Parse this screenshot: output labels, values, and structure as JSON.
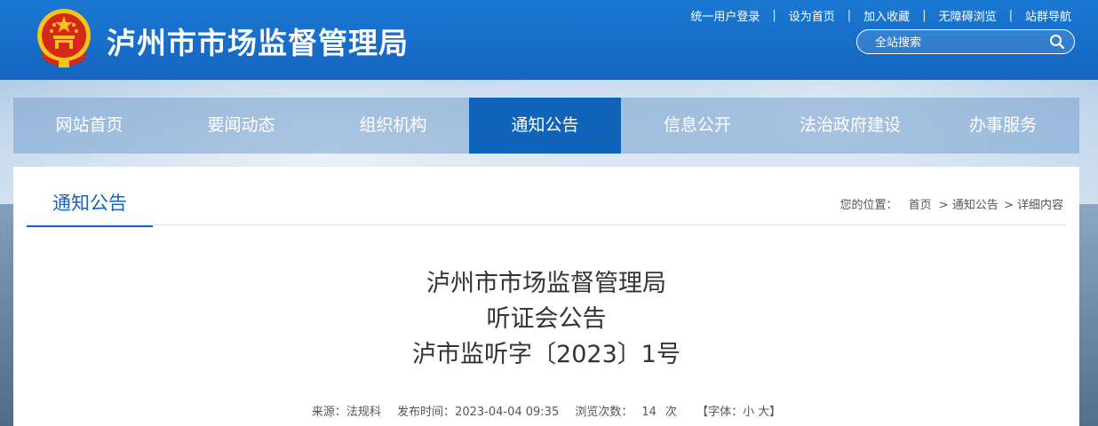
{
  "header": {
    "site_title": "泸州市市场监督管理局",
    "links": [
      "统一用户登录",
      "设为首页",
      "加入收藏",
      "无障碍浏览",
      "站群导航"
    ],
    "search_placeholder": "全站搜索"
  },
  "nav": {
    "items": [
      "网站首页",
      "要闻动态",
      "组织机构",
      "通知公告",
      "信息公开",
      "法治政府建设",
      "办事服务"
    ],
    "active_index": 3
  },
  "content": {
    "section_title": "通知公告",
    "breadcrumb": {
      "label": "您的位置：",
      "items": [
        "首页",
        "> 通知公告",
        "> 详细内容"
      ]
    },
    "headline": {
      "line1": "泸州市市场监督管理局",
      "line2": "听证会公告",
      "line3": "泸市监听字〔2023〕1号"
    },
    "meta": {
      "source_label": "来源：",
      "source": "法规科",
      "publish_label": "发布时间：",
      "publish_time": "2023-04-04 09:35",
      "views_label": "浏览次数：",
      "views": "14",
      "views_unit": "次",
      "font_label": "【字体：",
      "font_small": "小",
      "font_large": "大】"
    }
  },
  "colors": {
    "brand_blue": "#1565c0",
    "nav_active": "#0f63b8"
  }
}
